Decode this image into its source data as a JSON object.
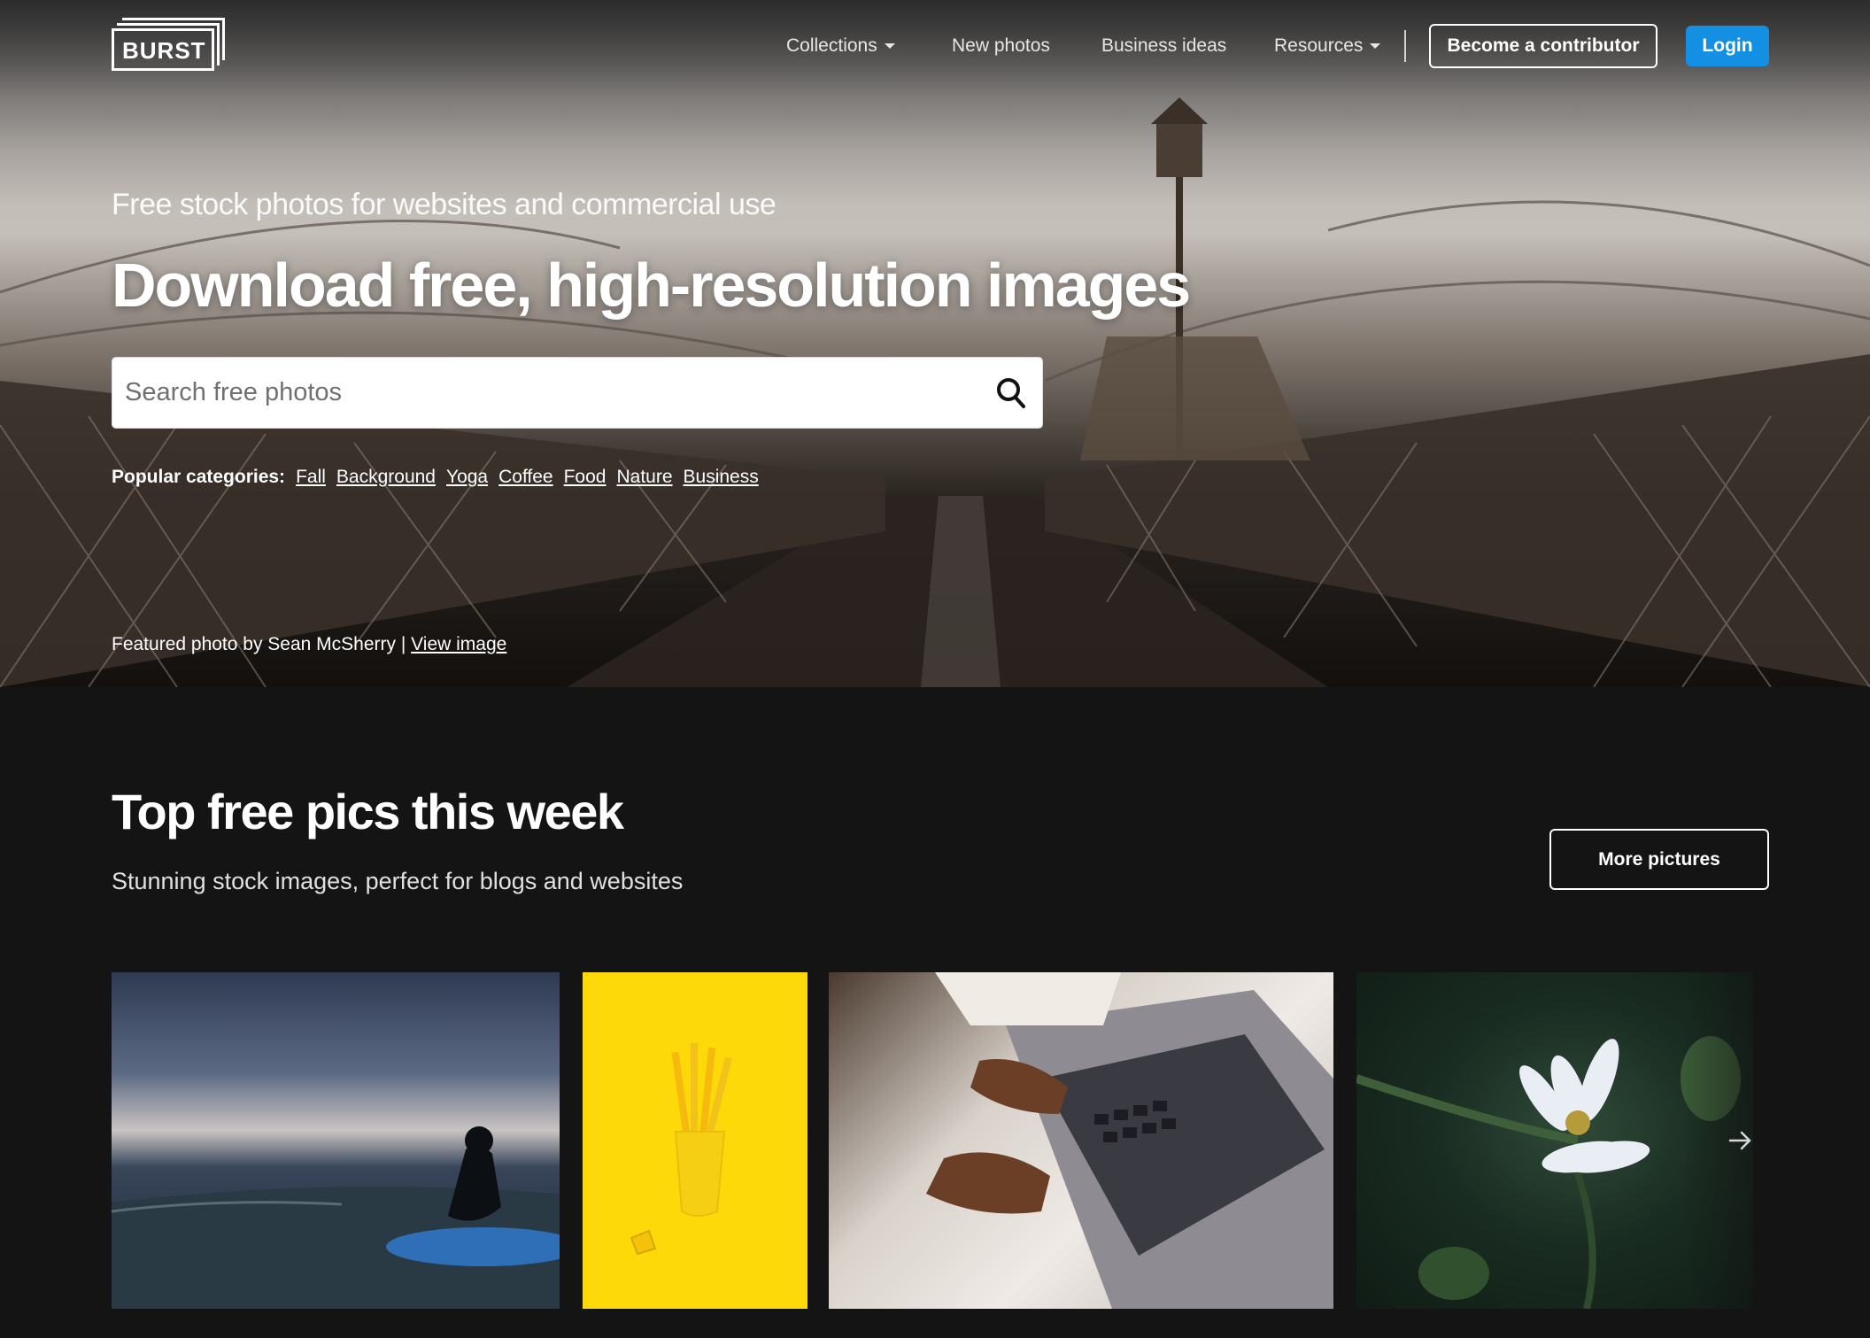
{
  "brand": {
    "logo_text": "BURST"
  },
  "nav": {
    "items": [
      {
        "label": "Collections",
        "has_dropdown": true
      },
      {
        "label": "New photos",
        "has_dropdown": false
      },
      {
        "label": "Business ideas",
        "has_dropdown": false
      },
      {
        "label": "Resources",
        "has_dropdown": true
      }
    ],
    "contributor_button": "Become a contributor",
    "login_button": "Login"
  },
  "hero": {
    "tagline": "Free stock photos for websites and commercial use",
    "headline": "Download free, high-resolution images",
    "search": {
      "placeholder": "Search free photos",
      "value": ""
    },
    "popular_label": "Popular categories:",
    "categories": [
      "Fall",
      "Background",
      "Yoga",
      "Coffee",
      "Food",
      "Nature",
      "Business"
    ],
    "featured_text": "Featured photo by Sean McSherry |",
    "featured_link": "View image"
  },
  "section": {
    "title": "Top free pics this week",
    "subtitle": "Stunning stock images, perfect for blogs and websites",
    "more_button": "More pictures"
  },
  "photos": [
    {
      "subject": "surfer-in-ocean"
    },
    {
      "subject": "yellow-pencils-cup"
    },
    {
      "subject": "hands-typing-laptop"
    },
    {
      "subject": "white-flower"
    }
  ],
  "colors": {
    "primary": "#1390e4",
    "dark_bg": "#141414",
    "yellow": "#fdd90a"
  }
}
